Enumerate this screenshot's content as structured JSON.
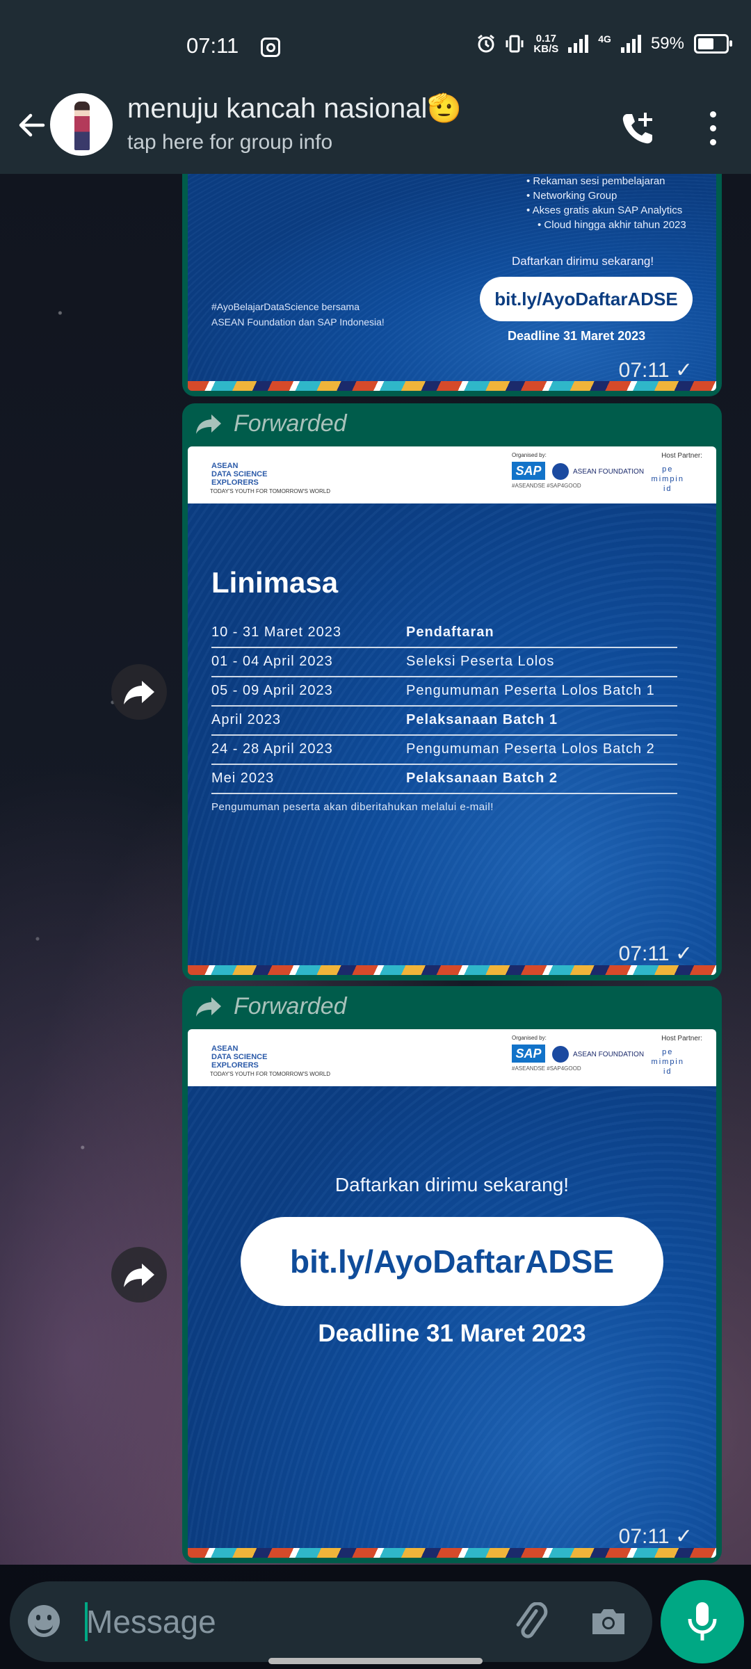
{
  "status_bar": {
    "time": "07:11",
    "net_speed_value": "0.17",
    "net_speed_unit": "KB/S",
    "network": "4G",
    "battery": "59%",
    "icons": [
      "instagram-icon",
      "alarm-icon",
      "vibrate-icon",
      "signal-icon",
      "battery-icon"
    ]
  },
  "header": {
    "title": "menuju kancah nasional🫡",
    "subtitle": "tap here for group info"
  },
  "messages": [
    {
      "forwarded_label": "",
      "time": "07:11",
      "slide": {
        "bullets": [
          "Rekaman sesi pembelajaran",
          "Networking Group",
          "Akses gratis akun SAP Analytics",
          "Cloud hingga akhir tahun 2023"
        ],
        "hashtag_line1": "#AyoBelajarDataScience bersama",
        "hashtag_line2": "ASEAN Foundation dan SAP Indonesia!",
        "cta": "Daftarkan dirimu sekarang!",
        "link": "bit.ly/AyoDaftarADSE",
        "deadline": "Deadline 31 Maret 2023"
      }
    },
    {
      "forwarded_label": "Forwarded",
      "time": "07:11",
      "slide": {
        "title": "Linimasa",
        "rows": [
          {
            "date": "10 - 31 Maret 2023",
            "event": "Pendaftaran"
          },
          {
            "date": "01 - 04 April 2023",
            "event": "Seleksi Peserta Lolos"
          },
          {
            "date": "05 - 09 April 2023",
            "event": "Pengumuman Peserta Lolos Batch 1"
          },
          {
            "date": "April 2023",
            "event": "Pelaksanaan Batch 1"
          },
          {
            "date": "24 - 28 April 2023",
            "event": "Pengumuman Peserta Lolos Batch 2"
          },
          {
            "date": "Mei 2023",
            "event": "Pelaksanaan Batch 2"
          }
        ],
        "note": "Pengumuman peserta akan diberitahukan melalui e-mail!"
      }
    },
    {
      "forwarded_label": "Forwarded",
      "time": "07:11",
      "slide": {
        "cta": "Daftarkan dirimu sekarang!",
        "link": "bit.ly/AyoDaftarADSE",
        "deadline": "Deadline 31 Maret 2023"
      }
    }
  ],
  "slide_header": {
    "adse_line1": "ASEAN",
    "adse_line2": "DATA SCIENCE",
    "adse_line3": "EXPLORERS",
    "tagline": "TODAY'S YOUTH FOR TOMORROW'S WORLD",
    "organised_by": "Organised by:",
    "sap": "SAP",
    "asean_foundation": "ASEAN FOUNDATION",
    "hashtags": "#ASEANDSE #SAP4GOOD",
    "host_partner": "Host Partner:",
    "pe_line1": "pe",
    "pe_line2": "mimpin",
    "pe_line3": "id"
  },
  "composer": {
    "placeholder": "Message"
  },
  "colors": {
    "header_bg": "#1f2c34",
    "bubble_out": "#005c4b",
    "accent": "#00a884"
  }
}
